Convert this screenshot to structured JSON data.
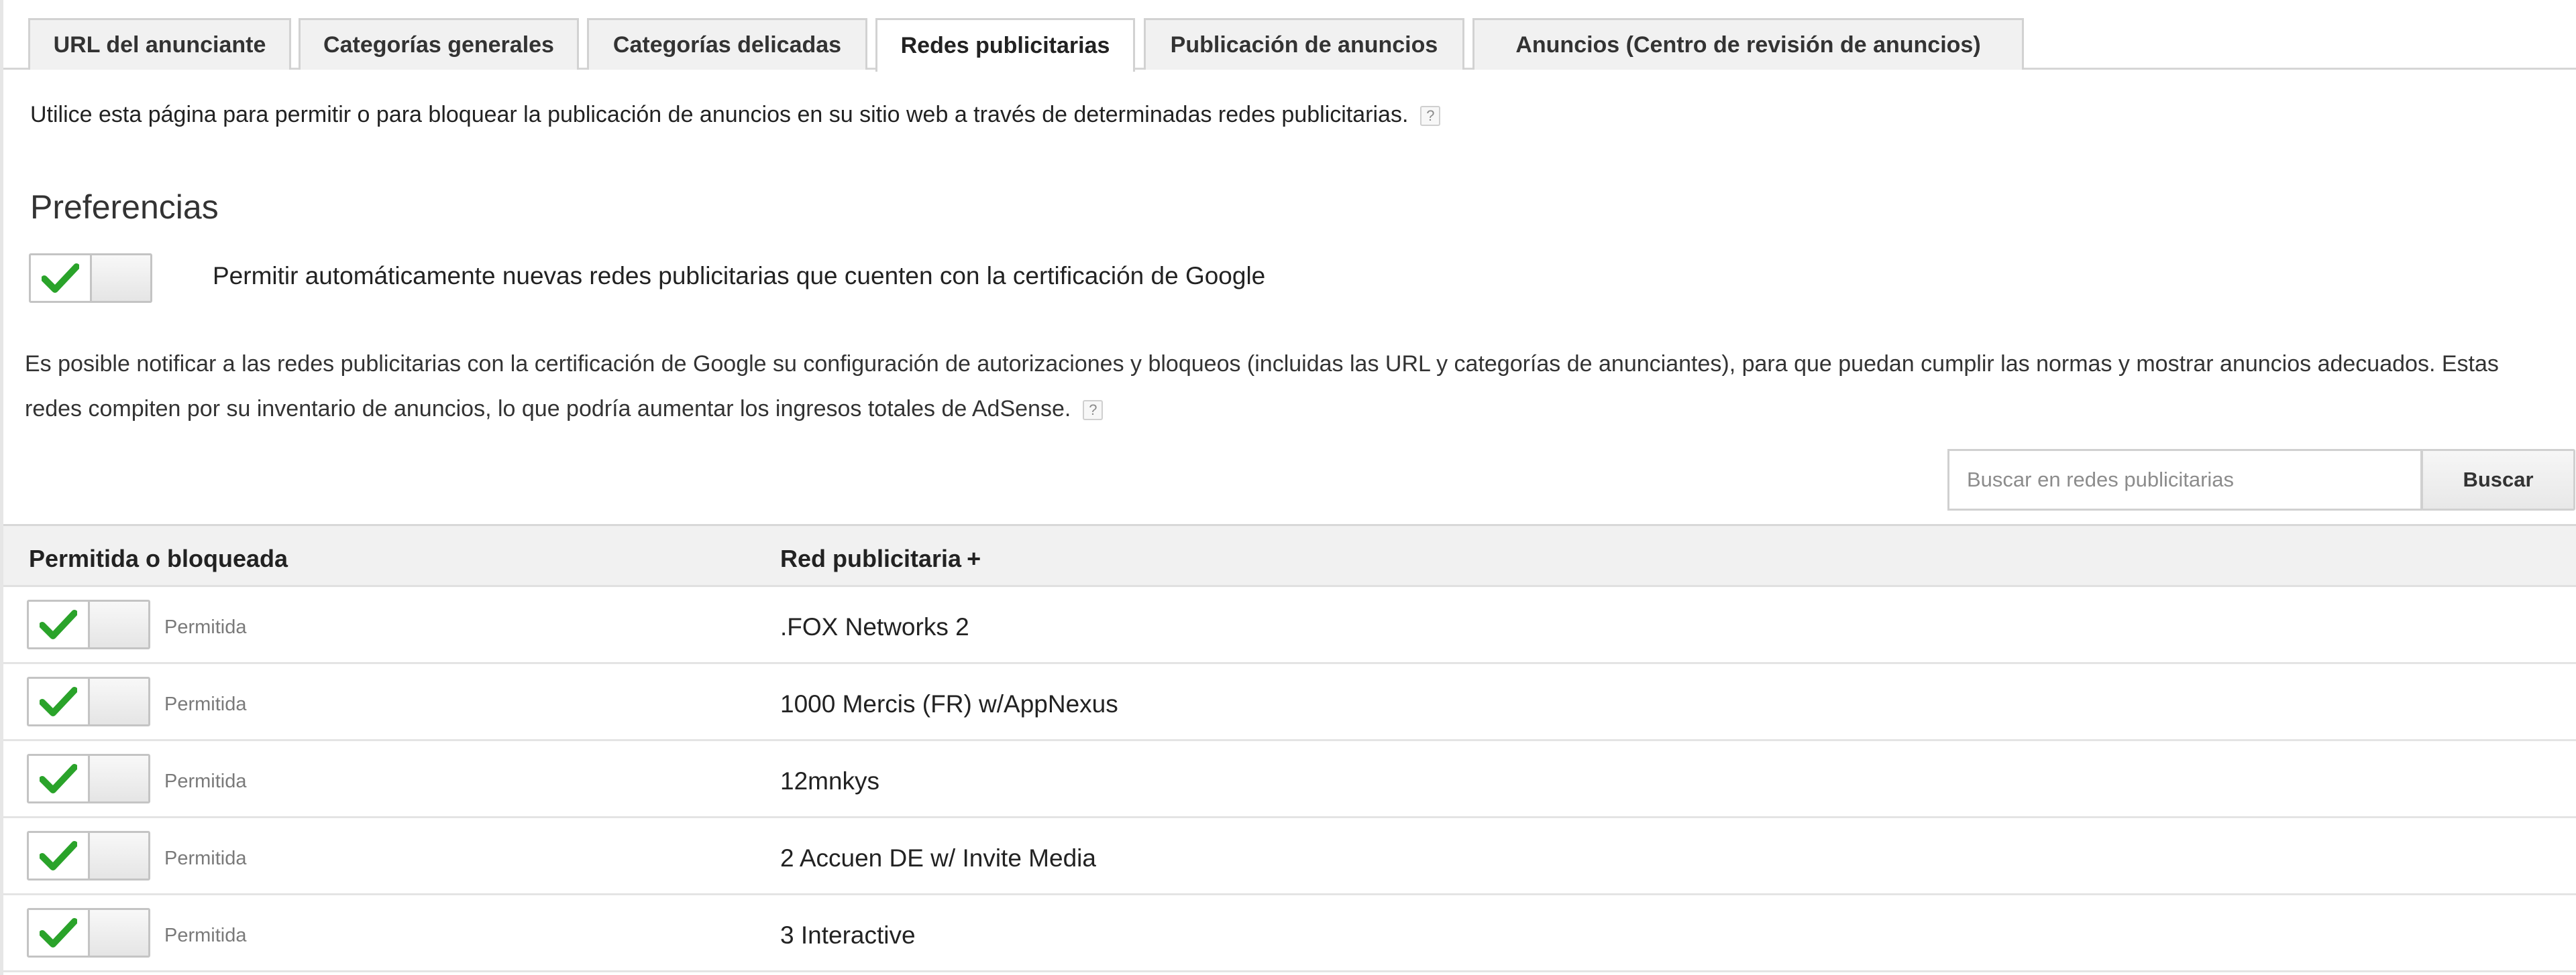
{
  "tabs": [
    {
      "label": "URL del anunciante"
    },
    {
      "label": "Categorías generales"
    },
    {
      "label": "Categorías delicadas"
    },
    {
      "label": "Redes publicitarias",
      "active": true
    },
    {
      "label": "Publicación de anuncios"
    },
    {
      "label": "Anuncios (Centro de revisión de anuncios)"
    }
  ],
  "intro_text": "Utilice esta página para permitir o para bloquear la publicación de anuncios en su sitio web a través de determinadas redes publicitarias.",
  "help_glyph": "?",
  "preferences": {
    "title": "Preferencias",
    "auto_allow_label": "Permitir automáticamente nuevas redes publicitarias que cuenten con la certificación de Google",
    "auto_allow_enabled": true
  },
  "notice_text": "Es posible notificar a las redes publicitarias con la certificación de Google su configuración de autorizaciones y bloqueos (incluidas las URL y categorías de anunciantes), para que puedan cumplir las normas y mostrar anuncios adecuados. Estas redes compiten por su inventario de anuncios, lo que podría aumentar los ingresos totales de AdSense.",
  "search": {
    "placeholder": "Buscar en redes publicitarias",
    "value": "",
    "button_label": "Buscar"
  },
  "table": {
    "columns": {
      "status": "Permitida o bloqueada",
      "network": "Red publicitaria",
      "sort_indicator": "+"
    },
    "rows": [
      {
        "status": "Permitida",
        "network": ".FOX Networks 2",
        "enabled": true
      },
      {
        "status": "Permitida",
        "network": "1000 Mercis (FR) w/AppNexus",
        "enabled": true
      },
      {
        "status": "Permitida",
        "network": "12mnkys",
        "enabled": true
      },
      {
        "status": "Permitida",
        "network": "2 Accuen DE w/ Invite Media",
        "enabled": true
      },
      {
        "status": "Permitida",
        "network": "3 Interactive",
        "enabled": true
      }
    ]
  },
  "colors": {
    "check_green": "#2aa32a",
    "tab_bg": "#f1f1f1",
    "header_bg": "#f1f1f1",
    "border": "#d2d2d2"
  },
  "icons": {
    "toggle_on": "check-icon",
    "help": "help-icon"
  }
}
